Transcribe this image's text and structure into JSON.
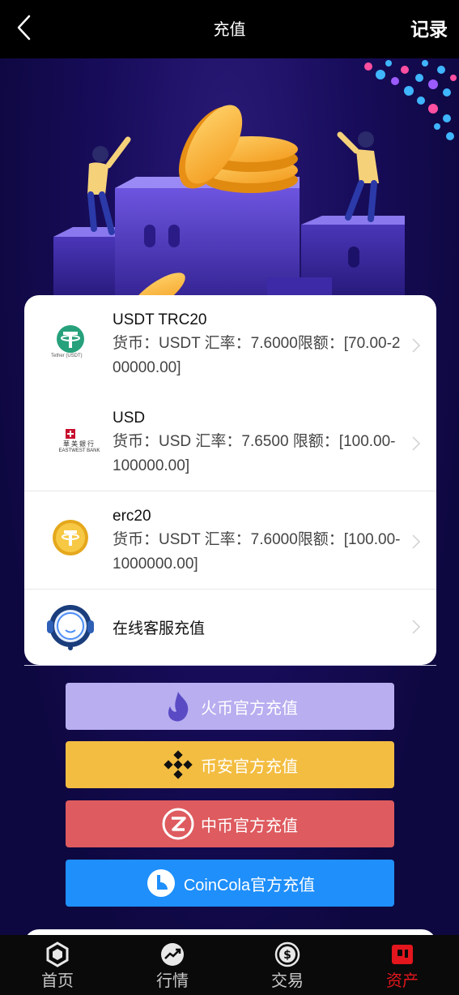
{
  "header": {
    "title": "充值",
    "record_label": "记录"
  },
  "channels": [
    {
      "name": "USDT TRC20",
      "desc": "货币：USDT 汇率：7.6000限额：[70.00-200000.00]",
      "logo": "tether-icon",
      "logo_caption": "Tether (USDT)"
    },
    {
      "name": "USD",
      "desc": "货币：USD 汇率：7.6500 限额：[100.00-100000.00]",
      "logo": "eastwest-bank-icon",
      "logo_caption_cn": "華美銀行",
      "logo_caption": "EASTWEST BANK"
    },
    {
      "name": "erc20",
      "desc": "货币：USDT 汇率：7.6000限额：[100.00-1000000.00]",
      "logo": "gold-coin-icon"
    }
  ],
  "online_service": {
    "label": "在线客服充值",
    "logo": "headset-icon"
  },
  "official_buttons": [
    {
      "label": "火币官方充值",
      "icon": "flame-icon",
      "color": "#b8aef0"
    },
    {
      "label": "币安官方充值",
      "icon": "binance-icon",
      "color": "#f3bd41"
    },
    {
      "label": "中币官方充值",
      "icon": "zb-icon",
      "color": "#de5b5f"
    },
    {
      "label": "CoinCola官方充值",
      "icon": "coincola-icon",
      "color": "#1e8ffb"
    }
  ],
  "tabs": [
    {
      "label": "首页",
      "icon": "home-icon",
      "active": false
    },
    {
      "label": "行情",
      "icon": "trend-icon",
      "active": false
    },
    {
      "label": "交易",
      "icon": "dollar-icon",
      "active": false
    },
    {
      "label": "资产",
      "icon": "wallet-icon",
      "active": true
    }
  ],
  "colors": {
    "active_tab": "#e3161d",
    "background": "#170c5a"
  }
}
